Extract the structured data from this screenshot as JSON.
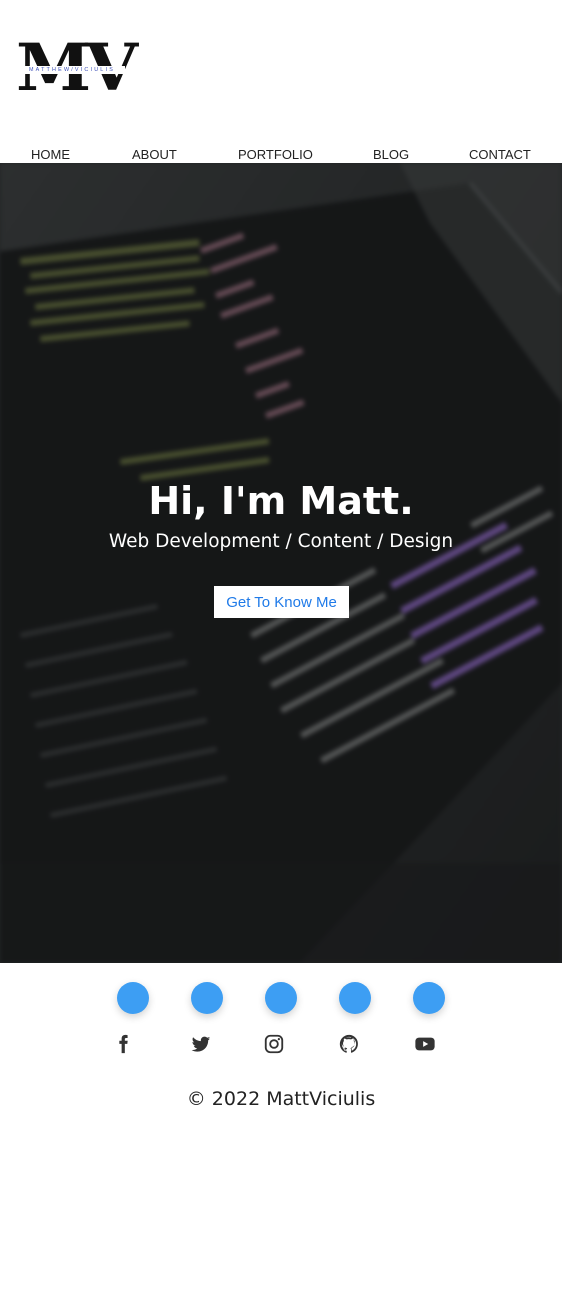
{
  "logo": {
    "letters": "MV",
    "subtitle": "MATTHEW/VICIULIS"
  },
  "nav": {
    "items": [
      {
        "label": "HOME"
      },
      {
        "label": "ABOUT"
      },
      {
        "label": "PORTFOLIO"
      },
      {
        "label": "BLOG"
      },
      {
        "label": "CONTACT"
      }
    ]
  },
  "hero": {
    "title": "Hi, I'm Matt.",
    "tagline": "Web Development / Content / Design",
    "cta_label": "Get To Know Me",
    "background": "blurred-code-screen-photo"
  },
  "social": {
    "dot_color": "#3d9ef3",
    "icons": [
      "facebook-icon",
      "twitter-icon",
      "instagram-icon",
      "github-icon",
      "youtube-icon"
    ]
  },
  "footer": {
    "copyright": "© 2022 MattViciulis"
  },
  "colors": {
    "accent": "#1f7ae8",
    "text": "#222222"
  }
}
